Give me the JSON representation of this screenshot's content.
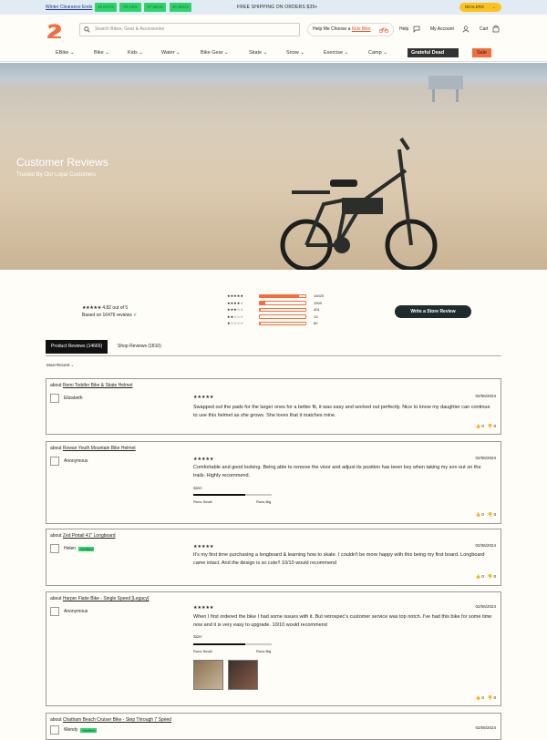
{
  "promo": {
    "ends": "Winter Clearance Ends",
    "countdown": [
      "15 DAYS",
      "09 HRS",
      "07 MINS",
      "40 SECS"
    ],
    "shipping": "FREE SHIPPING ON ORDERS $35+",
    "dealers": "DEALERS",
    "dealers_arrow": "→"
  },
  "header": {
    "search_placeholder": "Search Bikes, Gear & Accessories",
    "kids_prefix": "Help Me Choose a ",
    "kids_link": "Kids Bike",
    "help": "Help",
    "account": "My Account",
    "cart": "Cart"
  },
  "nav": {
    "items": [
      "EBike",
      "Bike",
      "Kids",
      "Water",
      "Bike Gear",
      "Skate",
      "Snow",
      "Exercise",
      "Camp"
    ],
    "featured": "Grateful Dead",
    "sale": "Sale"
  },
  "hero": {
    "title": "Customer Reviews",
    "subtitle": "Trusted By Our Loyal Customers"
  },
  "summary": {
    "stars": "★★★★★",
    "rating": "4.82 out of 5",
    "based_on": "Based on 16476 reviews",
    "distribution": [
      {
        "stars": "★★★★★",
        "count": "14020",
        "pct": 0.851
      },
      {
        "stars": "★★★★☆",
        "count": "1909",
        "pct": 0.116
      },
      {
        "stars": "★★★☆☆",
        "count": "401",
        "pct": 0.024
      },
      {
        "stars": "★★☆☆☆",
        "count": "13",
        "pct": 0.001
      },
      {
        "stars": "★☆☆☆☆",
        "count": "82",
        "pct": 0.005
      }
    ],
    "write_button": "Write a Store Review"
  },
  "tabs": {
    "product": "Product Reviews (14666)",
    "shop": "Shop Reviews (1810)"
  },
  "sort": "Most Recent",
  "reviews": [
    {
      "about": "about ",
      "product": "Remi Toddler Bike & Skate Helmet",
      "name": "Elizabeth",
      "stars": "★★★★★",
      "date": "02/06/2024",
      "text": "Swapped out the pads for the larger ones for a better fit, it was easy and worked out perfectly. Nice to know my daughter can continue to use this helmet as she grows. She loves that it matches mine.",
      "up": "0",
      "down": "0"
    },
    {
      "about": "about ",
      "product": "Rowan Youth Mountain Bike Helmet",
      "name": "Anonymous",
      "stars": "★★★★★",
      "date": "02/06/2024",
      "text": "Comfortable and good looking. Being able to remove the visor and adjust its position has been key when taking my son out on the trails. Highly recommend.",
      "size_label": "Size:",
      "size_left": "Runs Small",
      "size_right": "Runs Big",
      "size_fit": 0.66,
      "up": "0",
      "down": "0"
    },
    {
      "about": "about ",
      "product": "Zed Pintail 41\" Longboard",
      "name": "Helen",
      "verified": "Verified",
      "stars": "★★★★★",
      "date": "02/06/2024",
      "text": "It's my first time purchasing a longboard & learning how to skate. I couldn't be more happy with this being my first board. Longboard came intact. And the design is so cute!! 10/10 would recommend",
      "up": "0",
      "down": "0"
    },
    {
      "about": "about ",
      "product": "Harper Flatie Bike - Single Speed [Legacy]",
      "name": "Anonymous",
      "stars": "★★★★★",
      "date": "02/06/2024",
      "text": "When I first ordered the bike I had some issues with it. But retrospec's customer service was top notch. I've had this bike for some time now and it is very easy to upgrade. 10/10 would recommend",
      "size_label": "Size:",
      "size_left": "Runs Small",
      "size_right": "Runs Big",
      "size_fit": 0.66,
      "up": "0",
      "down": "0"
    },
    {
      "about": "about ",
      "product": "Chatham Beach Cruiser Bike - Step Through 7 Speed",
      "name": "Wendy",
      "verified": "Verified",
      "date": "02/05/2024"
    }
  ],
  "colors": {
    "accent": "#f46d3c",
    "countdown": "#2fd36b",
    "dealers": "#ffc21a",
    "button_dark": "#1e2c2e"
  }
}
